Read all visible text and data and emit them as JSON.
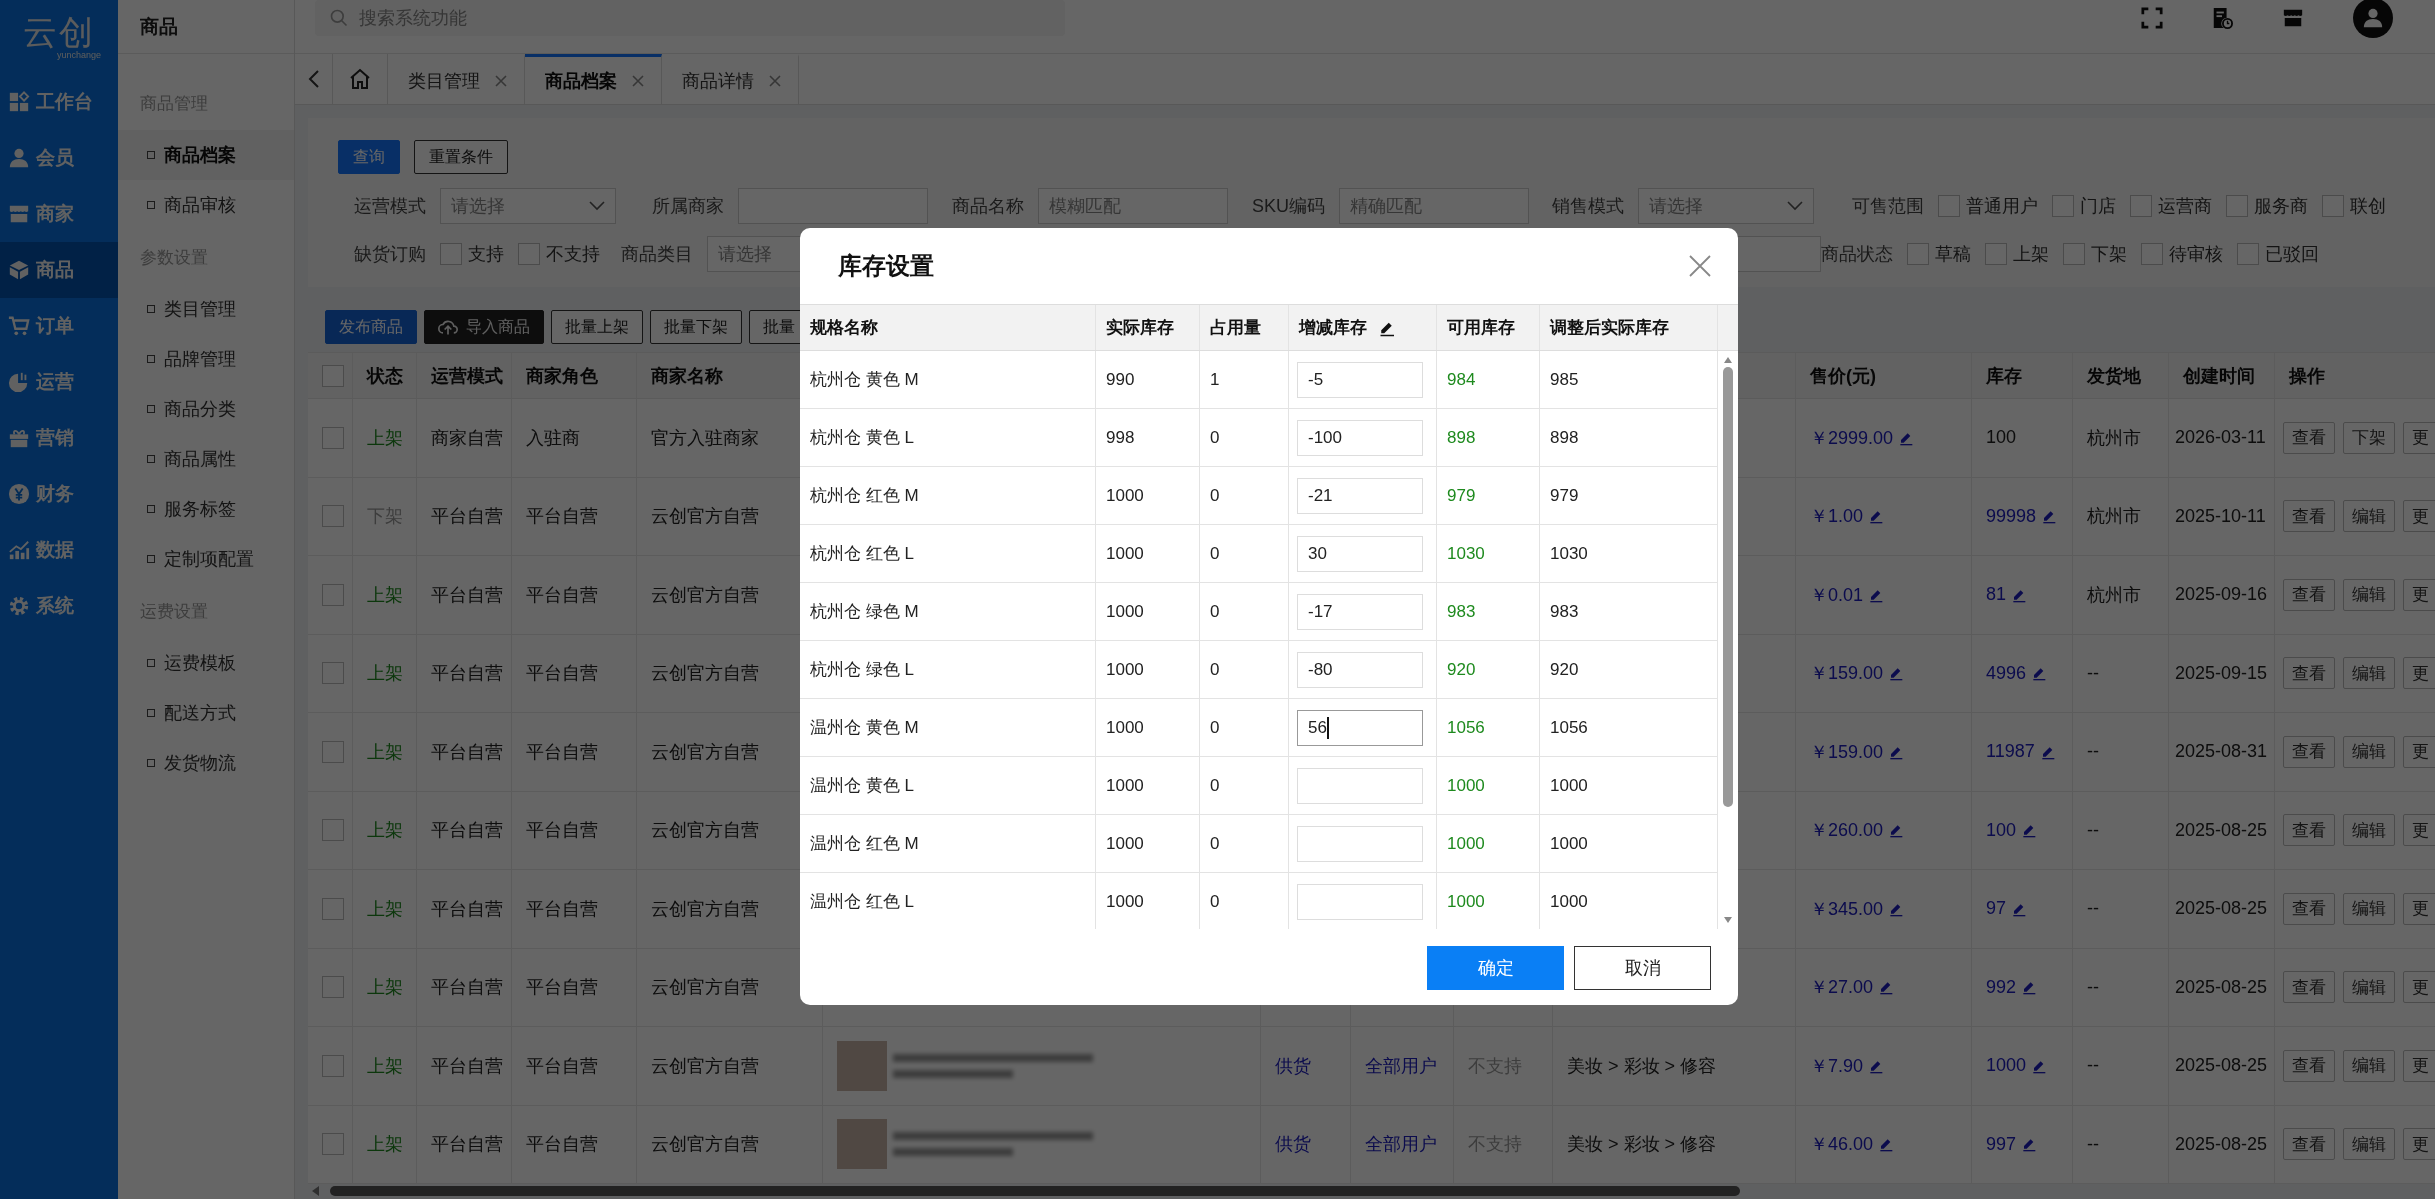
{
  "sidebar": {
    "logo": "云创",
    "logo_subtext": "yunchange",
    "items": [
      {
        "label": "工作台",
        "selected": false
      },
      {
        "label": "会员",
        "selected": false
      },
      {
        "label": "商家",
        "selected": false
      },
      {
        "label": "商品",
        "selected": true
      },
      {
        "label": "订单",
        "selected": false
      },
      {
        "label": "运营",
        "selected": false
      },
      {
        "label": "营销",
        "selected": false
      },
      {
        "label": "财务",
        "selected": false
      },
      {
        "label": "数据",
        "selected": false
      },
      {
        "label": "系统",
        "selected": false
      }
    ]
  },
  "subnav": {
    "title": "商品",
    "groups": [
      {
        "label": "商品管理",
        "items": [
          {
            "label": "商品档案",
            "selected": true
          },
          {
            "label": "商品审核",
            "selected": false
          }
        ]
      },
      {
        "label": "参数设置",
        "items": [
          {
            "label": "类目管理",
            "selected": false
          },
          {
            "label": "品牌管理",
            "selected": false
          },
          {
            "label": "商品分类",
            "selected": false
          },
          {
            "label": "商品属性",
            "selected": false
          },
          {
            "label": "服务标签",
            "selected": false
          },
          {
            "label": "定制项配置",
            "selected": false
          }
        ]
      },
      {
        "label": "运费设置",
        "items": [
          {
            "label": "运费模板",
            "selected": false
          },
          {
            "label": "配送方式",
            "selected": false
          },
          {
            "label": "发货物流",
            "selected": false
          }
        ]
      }
    ]
  },
  "search": {
    "placeholder": "搜索系统功能"
  },
  "tabs": [
    {
      "label": "类目管理",
      "selected": false
    },
    {
      "label": "商品档案",
      "selected": true
    },
    {
      "label": "商品详情",
      "selected": false
    }
  ],
  "filters": {
    "buttons": [
      {
        "label": "查询",
        "kind": "primary"
      },
      {
        "label": "重置条件",
        "kind": "default"
      }
    ],
    "rows": [
      [
        {
          "kind": "select",
          "label": "运营模式",
          "placeholder": "请选择"
        },
        {
          "kind": "input",
          "label": "所属商家"
        },
        {
          "kind": "input",
          "label": "商品名称",
          "placeholder": "模糊匹配"
        },
        {
          "kind": "input",
          "label": "SKU编码",
          "placeholder": "精确匹配"
        },
        {
          "kind": "select",
          "label": "销售模式",
          "placeholder": "请选择"
        },
        {
          "kind": "checks",
          "label": "可售范围",
          "options": [
            {
              "label": "普通用户",
              "checked": false
            },
            {
              "label": "门店",
              "checked": false
            },
            {
              "label": "运营商",
              "checked": false
            },
            {
              "label": "服务商",
              "checked": false
            },
            {
              "label": "联创",
              "checked": false
            }
          ]
        }
      ],
      [
        {
          "kind": "checks",
          "label": "缺货订购",
          "options": [
            {
              "label": "支持",
              "checked": false
            },
            {
              "label": "不支持",
              "checked": false
            }
          ]
        },
        {
          "kind": "select",
          "label": "商品类目",
          "placeholder": "请选择"
        },
        "",
        "",
        {
          "kind": "input"
        },
        {
          "kind": "checks",
          "label": "商品状态",
          "options": [
            {
              "label": "草稿",
              "checked": false
            },
            {
              "label": "上架",
              "checked": false
            },
            {
              "label": "下架",
              "checked": false
            },
            {
              "label": "待审核",
              "checked": false
            },
            {
              "label": "已驳回",
              "checked": false
            }
          ]
        }
      ]
    ]
  },
  "toolbar": [
    {
      "label": "发布商品",
      "kind": "primary"
    },
    {
      "label": "导入商品",
      "kind": "import"
    },
    {
      "label": "批量上架",
      "kind": "default"
    },
    {
      "label": "批量下架",
      "kind": "default"
    },
    {
      "label": "批量",
      "kind": "default"
    }
  ],
  "table": {
    "header_checked": false,
    "columns": {
      "status": "状态",
      "mode": "运营模式",
      "role": "商家角色",
      "merchant": "商家名称",
      "price": "售价(元)",
      "stock": "库存",
      "origin": "发货地",
      "created": "创建时间",
      "actions": "操作"
    },
    "rows": [
      {
        "checked": false,
        "status": "上架",
        "listed": true,
        "mode": "商家自营",
        "role": "入驻商",
        "merchant": "官方入驻商家",
        "price": "￥2999.00",
        "price_editable": true,
        "stock": "100",
        "stock_editable": false,
        "origin": "杭州市",
        "created": "2026-03-11",
        "actions": [
          "查看",
          "下架",
          "更"
        ]
      },
      {
        "checked": false,
        "status": "下架",
        "listed": false,
        "mode": "平台自营",
        "role": "平台自营",
        "merchant": "云创官方自营",
        "price": "￥1.00",
        "price_editable": true,
        "stock": "99998",
        "stock_editable": true,
        "origin": "杭州市",
        "created": "2025-10-11",
        "actions": [
          "查看",
          "编辑",
          "更"
        ]
      },
      {
        "checked": false,
        "status": "上架",
        "listed": true,
        "mode": "平台自营",
        "role": "平台自营",
        "merchant": "云创官方自营",
        "price": "￥0.01",
        "price_editable": true,
        "stock": "81",
        "stock_editable": true,
        "origin": "杭州市",
        "created": "2025-09-16",
        "actions": [
          "查看",
          "编辑",
          "更"
        ]
      },
      {
        "checked": false,
        "status": "上架",
        "listed": true,
        "mode": "平台自营",
        "role": "平台自营",
        "merchant": "云创官方自营",
        "price": "￥159.00",
        "price_editable": true,
        "stock": "4996",
        "stock_editable": true,
        "origin": "--",
        "created": "2025-09-15",
        "actions": [
          "查看",
          "编辑",
          "更"
        ]
      },
      {
        "checked": false,
        "status": "上架",
        "listed": true,
        "mode": "平台自营",
        "role": "平台自营",
        "merchant": "云创官方自营",
        "price": "￥159.00",
        "price_editable": true,
        "stock": "11987",
        "stock_editable": true,
        "origin": "--",
        "created": "2025-08-31",
        "actions": [
          "查看",
          "编辑",
          "更"
        ]
      },
      {
        "checked": false,
        "status": "上架",
        "listed": true,
        "mode": "平台自营",
        "role": "平台自营",
        "merchant": "云创官方自营",
        "price": "￥260.00",
        "price_editable": true,
        "stock": "100",
        "stock_editable": true,
        "origin": "--",
        "created": "2025-08-25",
        "actions": [
          "查看",
          "编辑",
          "更"
        ]
      },
      {
        "checked": false,
        "status": "上架",
        "listed": true,
        "mode": "平台自营",
        "role": "平台自营",
        "merchant": "云创官方自营",
        "price": "￥345.00",
        "price_editable": true,
        "stock": "97",
        "stock_editable": true,
        "origin": "--",
        "created": "2025-08-25",
        "actions": [
          "查看",
          "编辑",
          "更"
        ]
      },
      {
        "checked": false,
        "status": "上架",
        "listed": true,
        "mode": "平台自营",
        "role": "平台自营",
        "merchant": "云创官方自营",
        "price": "￥27.00",
        "price_editable": true,
        "stock": "992",
        "stock_editable": true,
        "origin": "--",
        "created": "2025-08-25",
        "actions": [
          "查看",
          "编辑",
          "更"
        ]
      },
      {
        "checked": false,
        "status": "上架",
        "listed": true,
        "mode": "平台自营",
        "role": "平台自营",
        "merchant": "云创官方自营",
        "product_preview": true,
        "supply": "供货",
        "audience": "全部用户",
        "backorder": "不支持",
        "category": "美妆 > 彩妆 > 修容",
        "price": "￥7.90",
        "price_editable": true,
        "stock": "1000",
        "stock_editable": true,
        "origin": "--",
        "created": "2025-08-25",
        "actions": [
          "查看",
          "编辑",
          "更"
        ]
      },
      {
        "checked": false,
        "status": "上架",
        "listed": true,
        "mode": "平台自营",
        "role": "平台自营",
        "merchant": "云创官方自营",
        "product_preview": true,
        "supply": "供货",
        "audience": "全部用户",
        "backorder": "不支持",
        "category": "美妆 > 彩妆 > 修容",
        "price": "￥46.00",
        "price_editable": true,
        "stock": "997",
        "stock_editable": true,
        "origin": "--",
        "created": "2025-08-25",
        "actions": [
          "查看",
          "编辑",
          "更"
        ]
      }
    ]
  },
  "stock_dialog": {
    "title": "库存设置",
    "columns": [
      {
        "label": "规格名称"
      },
      {
        "label": "实际库存"
      },
      {
        "label": "占用量"
      },
      {
        "label": "增减库存",
        "editable": true
      },
      {
        "label": "可用库存"
      },
      {
        "label": "调整后实际库存"
      }
    ],
    "rows": [
      {
        "spec": "杭州仓 黄色 M",
        "actual": "990",
        "reserved": "1",
        "delta": "-5",
        "available": "984",
        "adjusted": "985",
        "focused": false
      },
      {
        "spec": "杭州仓 黄色 L",
        "actual": "998",
        "reserved": "0",
        "delta": "-100",
        "available": "898",
        "adjusted": "898",
        "focused": false
      },
      {
        "spec": "杭州仓 红色 M",
        "actual": "1000",
        "reserved": "0",
        "delta": "-21",
        "available": "979",
        "adjusted": "979",
        "focused": false
      },
      {
        "spec": "杭州仓 红色 L",
        "actual": "1000",
        "reserved": "0",
        "delta": "30",
        "available": "1030",
        "adjusted": "1030",
        "focused": false
      },
      {
        "spec": "杭州仓 绿色 M",
        "actual": "1000",
        "reserved": "0",
        "delta": "-17",
        "available": "983",
        "adjusted": "983",
        "focused": false
      },
      {
        "spec": "杭州仓 绿色 L",
        "actual": "1000",
        "reserved": "0",
        "delta": "-80",
        "available": "920",
        "adjusted": "920",
        "focused": false
      },
      {
        "spec": "温州仓 黄色 M",
        "actual": "1000",
        "reserved": "0",
        "delta": "56",
        "available": "1056",
        "adjusted": "1056",
        "focused": true
      },
      {
        "spec": "温州仓 黄色 L",
        "actual": "1000",
        "reserved": "0",
        "available": "1000",
        "adjusted": "1000",
        "focused": false
      },
      {
        "spec": "温州仓 红色 M",
        "actual": "1000",
        "reserved": "0",
        "available": "1000",
        "adjusted": "1000",
        "focused": false
      },
      {
        "spec": "温州仓 红色 L",
        "actual": "1000",
        "reserved": "0",
        "available": "1000",
        "adjusted": "1000",
        "focused": false
      }
    ],
    "buttons": [
      {
        "label": "确定",
        "kind": "primary"
      },
      {
        "label": "取消",
        "kind": "default"
      }
    ]
  }
}
